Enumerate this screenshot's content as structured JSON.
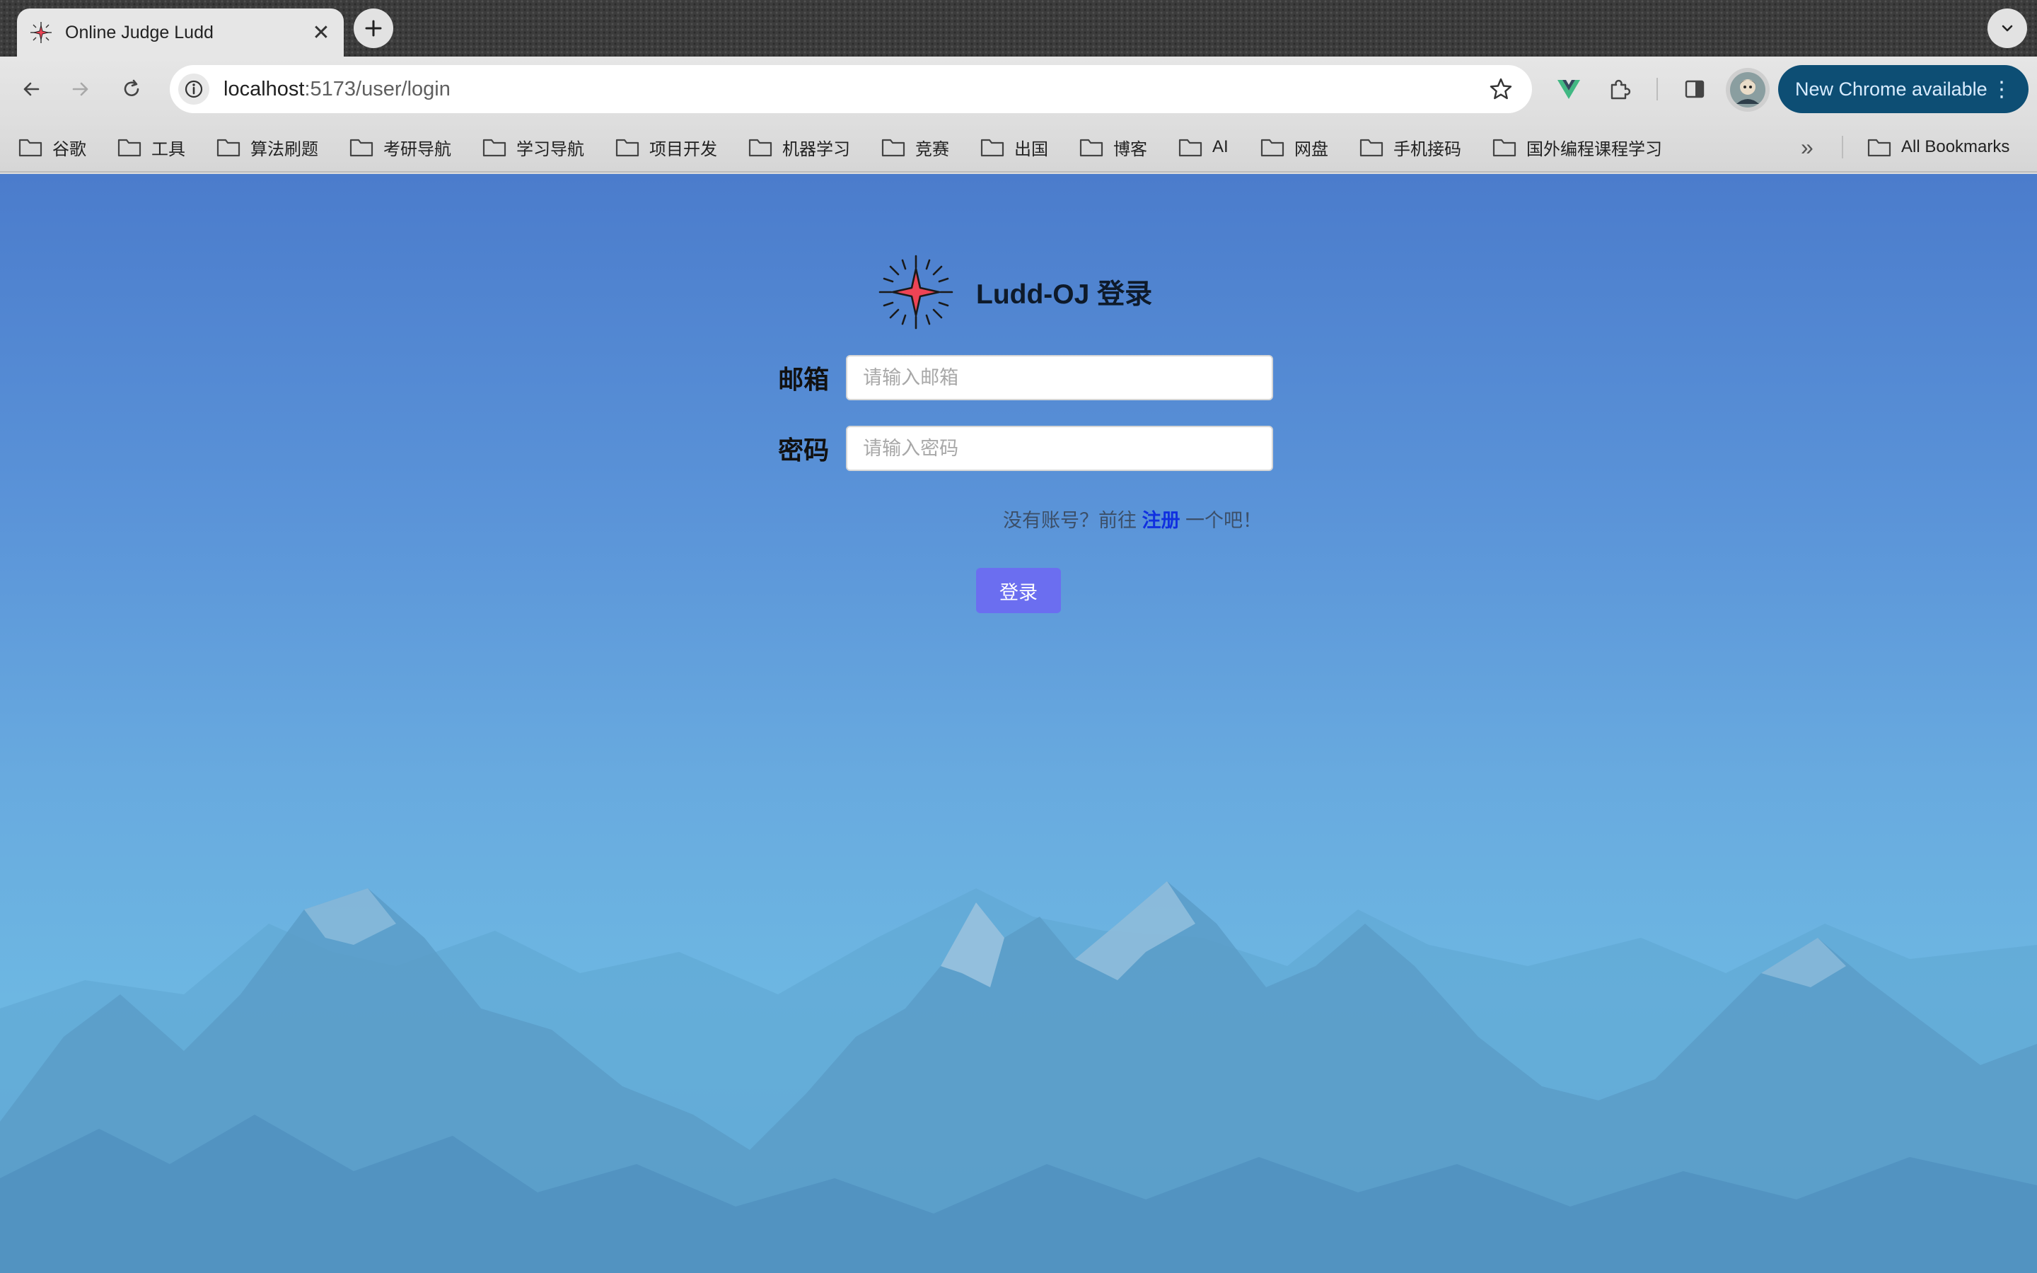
{
  "browser": {
    "tab": {
      "title": "Online Judge Ludd",
      "close_symbol": "✕"
    },
    "url": {
      "host": "localhost",
      "rest": ":5173/user/login"
    },
    "update_button": {
      "label": "New Chrome available",
      "menu_symbol": "⋮"
    },
    "bookmarks": [
      "谷歌",
      "工具",
      "算法刷题",
      "考研导航",
      "学习导航",
      "项目开发",
      "机器学习",
      "竞赛",
      "出国",
      "博客",
      "AI",
      "网盘",
      "手机接码",
      "国外编程课程学习"
    ],
    "more_bookmarks_symbol": "»",
    "all_bookmarks_label": "All Bookmarks"
  },
  "login": {
    "title": "Ludd-OJ 登录",
    "email_label": "邮箱",
    "email_placeholder": "请输入邮箱",
    "password_label": "密码",
    "password_placeholder": "请输入密码",
    "register_prefix": "没有账号？前往",
    "register_link": "注册",
    "register_suffix": "一个吧！",
    "submit_label": "登录"
  },
  "colors": {
    "accent_button": "#6b6ef0",
    "link": "#1030e0",
    "update_button_bg": "#0d4e74",
    "logo_star": "#ee4455"
  },
  "icons": {
    "back": "back-arrow-icon",
    "forward": "forward-arrow-icon",
    "reload": "reload-icon",
    "site_info": "info-icon",
    "bookmark_star": "star-icon",
    "vue_devtools": "vue-icon",
    "extensions": "puzzle-icon",
    "side_panel": "side-panel-icon",
    "bookmark_folder": "folder-icon",
    "logo": "compass-star-icon"
  }
}
